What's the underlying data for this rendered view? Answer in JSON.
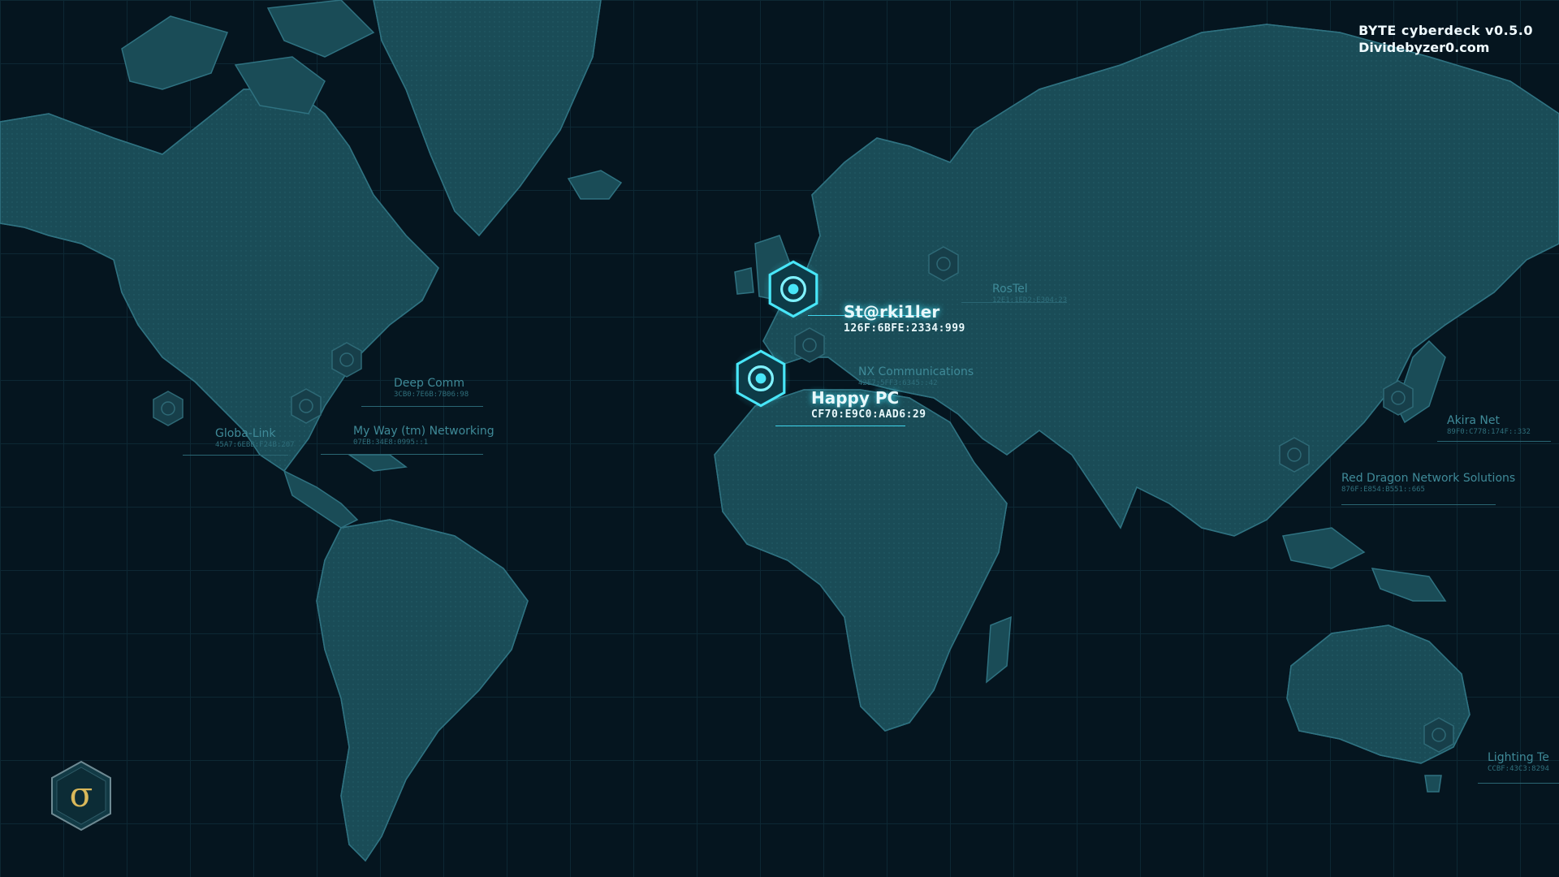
{
  "branding": {
    "app_name": "BYTE cyberdeck v0.5.0",
    "website": "Dividebyzer0.com"
  },
  "logo": {
    "glyph": "σ",
    "icon": "sigma-logo-icon",
    "color": "#d9b85a"
  },
  "colors": {
    "background": "#05151f",
    "land": "#1a4c57",
    "accent": "#3de0f5",
    "label": "#3f8a98"
  },
  "network_nodes": [
    {
      "name": "St@rki1ler",
      "address": "126F:6BFE:2334:999",
      "state": "active"
    },
    {
      "name": "Happy PC",
      "address": "CF70:E9C0:AAD6:29",
      "state": "active"
    },
    {
      "name": "RosTel",
      "address": "12E1:1ED2:E304:23",
      "state": "inactive"
    },
    {
      "name": "NX Communications",
      "address": "42E7:5FF3:6345::42",
      "state": "inactive"
    },
    {
      "name": "Deep Comm",
      "address": "3CB0:7E6B:7B06:98",
      "state": "inactive"
    },
    {
      "name": "Globa-Link",
      "address": "45A7:6EBB:F24B:207",
      "state": "inactive"
    },
    {
      "name": "My Way (tm) Networking",
      "address": "07EB:34E8:0995::1",
      "state": "inactive"
    },
    {
      "name": "Akira Net",
      "address": "89F0:C778:174F::332",
      "state": "inactive"
    },
    {
      "name": "Red Dragon Network Solutions",
      "address": "876F:E854:B551::665",
      "state": "inactive"
    },
    {
      "name": "Lighting Te",
      "address": "CCBF:43C3:8294",
      "state": "inactive"
    }
  ]
}
